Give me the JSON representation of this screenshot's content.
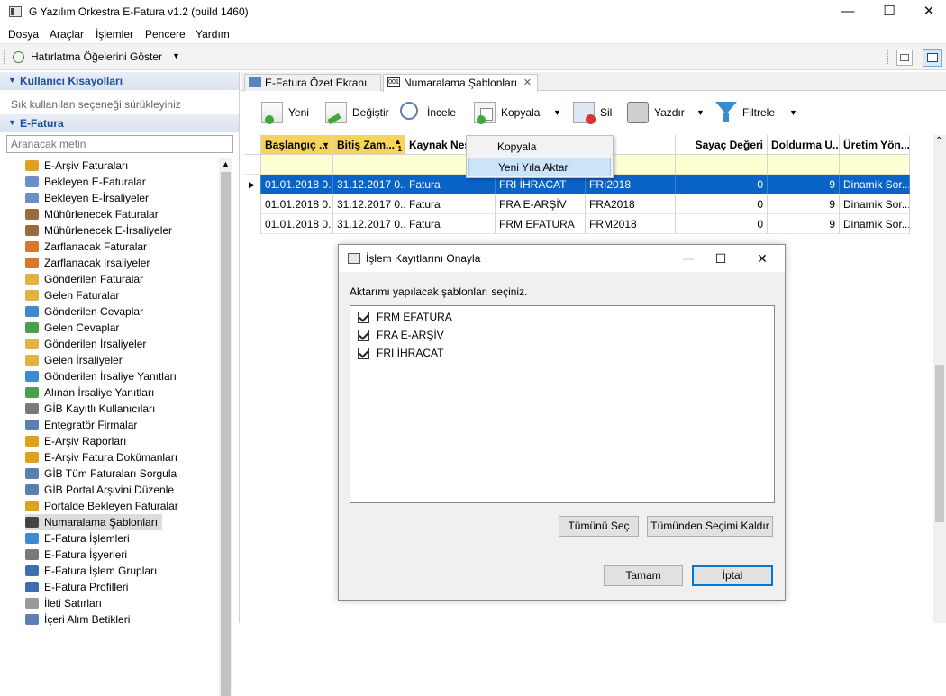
{
  "app": {
    "title": "G Yazılım Orkestra E-Fatura v1.2 (build 1460)"
  },
  "window_controls": {
    "minimize": "—",
    "maximize": "☐",
    "close": "✕"
  },
  "menu": [
    "Dosya",
    "Araçlar",
    "İşlemler",
    "Pencere",
    "Yardım"
  ],
  "top_toolbar": {
    "reminder_label": "Hatırlatma Öğelerini Göster"
  },
  "sidebar": {
    "shortcuts_header": "Kullanıcı Kısayolları",
    "shortcuts_hint": "Sık kullanılan seçeneği sürükleyiniz",
    "efatura_header": "E-Fatura",
    "search_placeholder": "Aranacak metin",
    "items": [
      {
        "label": "E-Arşiv Faturaları",
        "color": "#e0a020"
      },
      {
        "label": "Bekleyen E-Faturalar",
        "color": "#6c8fc7"
      },
      {
        "label": "Bekleyen E-İrsaliyeler",
        "color": "#6c8fc7"
      },
      {
        "label": "Mühürlenecek Faturalar",
        "color": "#9a6a3a"
      },
      {
        "label": "Mühürlenecek E-İrsaliyeler",
        "color": "#9a6a3a"
      },
      {
        "label": "Zarflanacak Faturalar",
        "color": "#d9772c"
      },
      {
        "label": "Zarflanacak İrsaliyeler",
        "color": "#d9772c"
      },
      {
        "label": "Gönderilen Faturalar",
        "color": "#e3b341"
      },
      {
        "label": "Gelen Faturalar",
        "color": "#e3b341"
      },
      {
        "label": "Gönderilen Cevaplar",
        "color": "#3c8bd0"
      },
      {
        "label": "Gelen Cevaplar",
        "color": "#4aa04a"
      },
      {
        "label": "Gönderilen İrsaliyeler",
        "color": "#e3b341"
      },
      {
        "label": "Gelen İrsaliyeler",
        "color": "#e3b341"
      },
      {
        "label": "Gönderilen İrsaliye Yanıtları",
        "color": "#3c8bd0"
      },
      {
        "label": "Alınan İrsaliye Yanıtları",
        "color": "#4aa04a"
      },
      {
        "label": "GİB Kayıtlı Kullanıcıları",
        "color": "#7a7a7a"
      },
      {
        "label": "Entegratör Firmalar",
        "color": "#5a7fb0"
      },
      {
        "label": "E-Arşiv Raporları",
        "color": "#e0a020"
      },
      {
        "label": "E-Arşiv Fatura Dokümanları",
        "color": "#e0a020"
      },
      {
        "label": "GİB Tüm Faturaları Sorgula",
        "color": "#5a7fb0"
      },
      {
        "label": "GİB Portal Arşivini Düzenle",
        "color": "#5a7fb0"
      },
      {
        "label": "Portalde Bekleyen Faturalar",
        "color": "#e0a020"
      },
      {
        "label": "Numaralama Şablonları",
        "color": "#444444"
      },
      {
        "label": "E-Fatura İşlemleri",
        "color": "#3c8bd0"
      },
      {
        "label": "E-Fatura İşyerleri",
        "color": "#7a7a7a"
      },
      {
        "label": "E-Fatura İşlem Grupları",
        "color": "#3c6fb0"
      },
      {
        "label": "E-Fatura Profilleri",
        "color": "#3c6fb0"
      },
      {
        "label": "İleti Satırları",
        "color": "#9a9a9a"
      },
      {
        "label": "İçeri Alım Betikleri",
        "color": "#5a7fb0"
      }
    ],
    "selected_index": 22
  },
  "tabs": [
    {
      "label": "E-Fatura Özet Ekranı",
      "active": false
    },
    {
      "label": "Numaralama Şablonları",
      "active": true,
      "closable": "✕"
    }
  ],
  "toolbar": {
    "new": "Yeni",
    "edit": "Değiştir",
    "inspect": "İncele",
    "copy": "Kopyala",
    "delete": "Sil",
    "print": "Yazdır",
    "filter": "Filtrele"
  },
  "grid": {
    "columns": [
      "Başlangıç ...",
      "Bitiş Zam...",
      "Kaynak Nes",
      "",
      "k",
      "Sayaç Değeri",
      "Doldurma U...",
      "Üretim Yön..."
    ],
    "rows": [
      [
        "01.01.2018 0...",
        "31.12.2017 0...",
        "Fatura",
        "FRI İHRACAT",
        "FRI2018",
        "0",
        "9",
        "Dinamik Sor..."
      ],
      [
        "01.01.2018 0...",
        "31.12.2017 0...",
        "Fatura",
        "FRA E-ARŞİV",
        "FRA2018",
        "0",
        "9",
        "Dinamik Sor..."
      ],
      [
        "01.01.2018 0...",
        "31.12.2017 0...",
        "Fatura",
        "FRM EFATURA",
        "FRM2018",
        "0",
        "9",
        "Dinamik Sor..."
      ]
    ],
    "selected_row": 0,
    "sort_indicator": "1"
  },
  "context_menu": {
    "items": [
      "Kopyala",
      "Yeni Yıla Aktar"
    ],
    "highlighted": 1
  },
  "dialog": {
    "title": "İşlem Kayıtlarını Onayla",
    "instruction": "Aktarımı yapılacak şablonları seçiniz.",
    "options": [
      {
        "label": "FRM EFATURA",
        "checked": true
      },
      {
        "label": "FRA E-ARŞİV",
        "checked": true
      },
      {
        "label": "FRI İHRACAT",
        "checked": true
      }
    ],
    "select_all": "Tümünü Seç",
    "deselect_all": "Tümünden Seçimi Kaldır",
    "ok": "Tamam",
    "cancel": "İptal"
  }
}
